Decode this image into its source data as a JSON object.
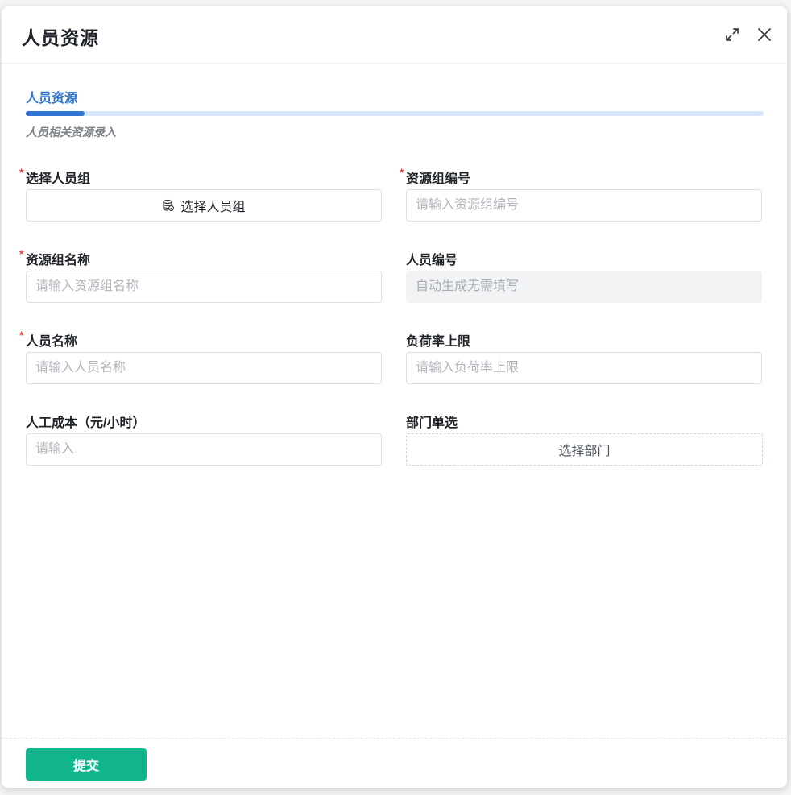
{
  "modal": {
    "title": "人员资源"
  },
  "steps": {
    "current_label": "人员资源",
    "description": "人员相关资源录入",
    "progress_percent": 8
  },
  "form": {
    "select_group": {
      "label": "选择人员组",
      "required_mark": "*",
      "button_label": "选择人员组",
      "icon": "database-icon"
    },
    "group_code": {
      "label": "资源组编号",
      "required_mark": "*",
      "placeholder": "请输入资源组编号",
      "value": ""
    },
    "group_name": {
      "label": "资源组名称",
      "required_mark": "*",
      "placeholder": "请输入资源组名称",
      "value": ""
    },
    "person_code": {
      "label": "人员编号",
      "placeholder": "自动生成无需填写",
      "value": ""
    },
    "person_name": {
      "label": "人员名称",
      "required_mark": "*",
      "placeholder": "请输入人员名称",
      "value": ""
    },
    "load_limit": {
      "label": "负荷率上限",
      "placeholder": "请输入负荷率上限",
      "value": ""
    },
    "labor_cost": {
      "label": "人工成本（元/小时）",
      "placeholder": "请输入",
      "value": ""
    },
    "department": {
      "label": "部门单选",
      "button_label": "选择部门"
    }
  },
  "footer": {
    "submit_label": "提交"
  },
  "colors": {
    "primary": "#2f74d0",
    "submit": "#10b48d",
    "required": "#e2463d"
  }
}
